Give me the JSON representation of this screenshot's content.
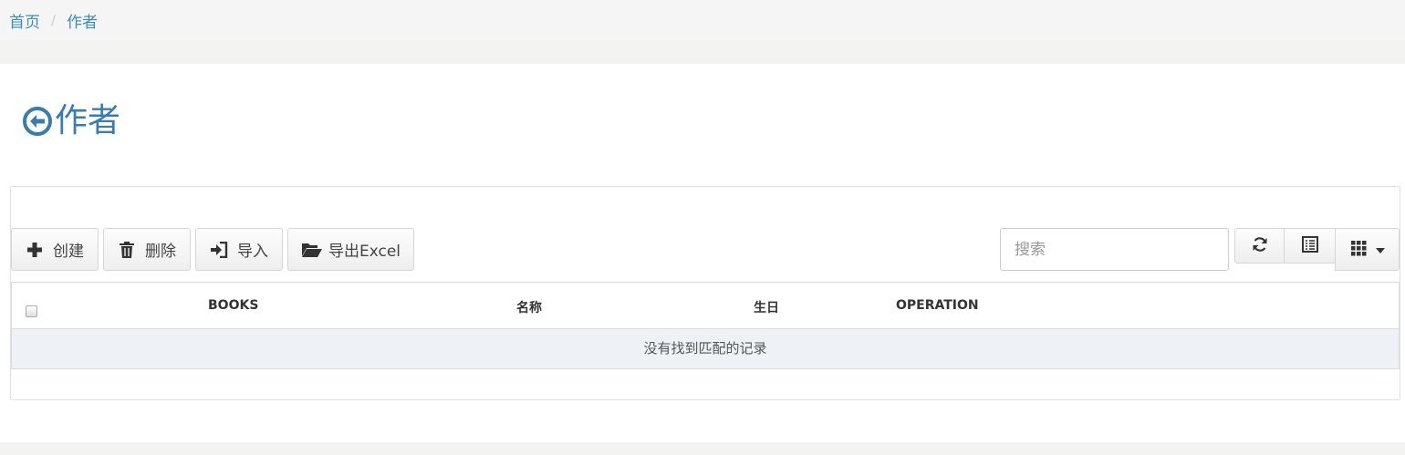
{
  "breadcrumb": {
    "home": "首页",
    "separator": "/",
    "current": "作者"
  },
  "page": {
    "title": "作者",
    "accent_color": "#3a7bb0"
  },
  "toolbar": {
    "create_label": "创建",
    "delete_label": "删除",
    "import_label": "导入",
    "export_label": "导出Excel",
    "search_placeholder": "搜索"
  },
  "table": {
    "columns": [
      "BOOKS",
      "名称",
      "生日",
      "OPERATION"
    ],
    "empty_message": "没有找到匹配的记录"
  },
  "icons": {
    "back": "arrow-circle-left-icon",
    "create": "plus-icon",
    "delete": "trash-icon",
    "import": "sign-in-icon",
    "export": "folder-open-icon",
    "refresh": "refresh-icon",
    "toggle_view": "list-alt-icon",
    "columns": "th-grid-icon",
    "dropdown": "caret-down-icon"
  }
}
